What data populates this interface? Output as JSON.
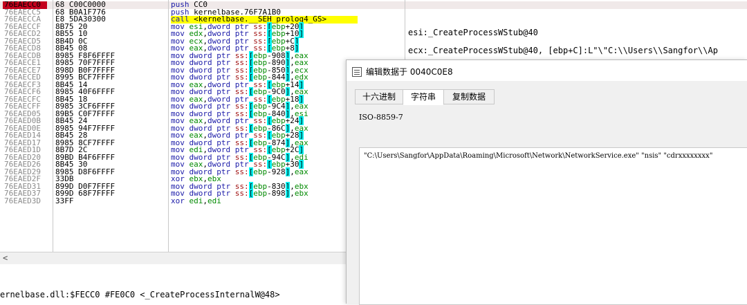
{
  "disasm": {
    "rows": [
      {
        "addr": "76EAECC0",
        "bytes": "68 C00C0000",
        "instr": "push CC0"
      },
      {
        "addr": "76EAECC5",
        "bytes": "68 B0A1F776",
        "instr": "push kernelbase.76F7A1B0"
      },
      {
        "addr": "76EAECCA",
        "bytes": "E8 5DA30300",
        "instr": "call <kernelbase.__SEH_prolog4_GS>"
      },
      {
        "addr": "76EAECCF",
        "bytes": "8B75 20",
        "instr": "mov esi,dword ptr ss:[ebp+20]"
      },
      {
        "addr": "76EAECD2",
        "bytes": "8B55 10",
        "instr": "mov edx,dword ptr ss:[ebp+10]"
      },
      {
        "addr": "76EAECD5",
        "bytes": "8B4D 0C",
        "instr": "mov ecx,dword ptr ss:[ebp+C]"
      },
      {
        "addr": "76EAECD8",
        "bytes": "8B45 08",
        "instr": "mov eax,dword ptr ss:[ebp+8]"
      },
      {
        "addr": "76EAECDB",
        "bytes": "8985 F8F6FFFF",
        "instr": "mov dword ptr ss:[ebp-908],eax"
      },
      {
        "addr": "76EAECE1",
        "bytes": "8985 70F7FFFF",
        "instr": "mov dword ptr ss:[ebp-890],eax"
      },
      {
        "addr": "76EAECE7",
        "bytes": "898D B0F7FFFF",
        "instr": "mov dword ptr ss:[ebp-850],ecx"
      },
      {
        "addr": "76EAECED",
        "bytes": "8995 BCF7FFFF",
        "instr": "mov dword ptr ss:[ebp-844],edx"
      },
      {
        "addr": "76EAECF3",
        "bytes": "8B45 14",
        "instr": "mov eax,dword ptr ss:[ebp+14]"
      },
      {
        "addr": "76EAECF6",
        "bytes": "8985 40F6FFFF",
        "instr": "mov dword ptr ss:[ebp-9C0],eax"
      },
      {
        "addr": "76EAECFC",
        "bytes": "8B45 18",
        "instr": "mov eax,dword ptr ss:[ebp+18]"
      },
      {
        "addr": "76EAECFF",
        "bytes": "8985 3CF6FFFF",
        "instr": "mov dword ptr ss:[ebp-9C4],eax"
      },
      {
        "addr": "76EAED05",
        "bytes": "89B5 C0F7FFFF",
        "instr": "mov dword ptr ss:[ebp-840],esi"
      },
      {
        "addr": "76EAED0B",
        "bytes": "8B45 24",
        "instr": "mov eax,dword ptr ss:[ebp+24]"
      },
      {
        "addr": "76EAED0E",
        "bytes": "8985 94F7FFFF",
        "instr": "mov dword ptr ss:[ebp-86C],eax"
      },
      {
        "addr": "76EAED14",
        "bytes": "8B45 28",
        "instr": "mov eax,dword ptr ss:[ebp+28]"
      },
      {
        "addr": "76EAED17",
        "bytes": "8985 8CF7FFFF",
        "instr": "mov dword ptr ss:[ebp-874],eax"
      },
      {
        "addr": "76EAED1D",
        "bytes": "8B7D 2C",
        "instr": "mov edi,dword ptr ss:[ebp+2C]"
      },
      {
        "addr": "76EAED20",
        "bytes": "89BD B4F6FFFF",
        "instr": "mov dword ptr ss:[ebp-94C],edi"
      },
      {
        "addr": "76EAED26",
        "bytes": "8B45 30",
        "instr": "mov eax,dword ptr ss:[ebp+30]"
      },
      {
        "addr": "76EAED29",
        "bytes": "8985 D8F6FFFF",
        "instr": "mov dword ptr ss:[ebp-928],eax"
      },
      {
        "addr": "76EAED2F",
        "bytes": "33DB",
        "instr": "xor ebx,ebx"
      },
      {
        "addr": "76EAED31",
        "bytes": "899D D0F7FFFF",
        "instr": "mov dword ptr ss:[ebp-830],ebx"
      },
      {
        "addr": "76EAED37",
        "bytes": "899D 68F7FFFF",
        "instr": "mov dword ptr ss:[ebp-898],ebx"
      },
      {
        "addr": "76EAED3D",
        "bytes": "33FF",
        "instr": "xor edi,edi"
      }
    ],
    "comments": [
      "esi:_CreateProcessWStub@40",
      "ecx:_CreateProcessWStub@40, [ebp+C]:L\"\\\"C:\\\\Users\\\\Sangfor\\\\Ap"
    ],
    "scroll_left_arrow": "<",
    "status": "ernelbase.dll:$FECC0 #FE0C0 <_CreateProcessInternalW@48>"
  },
  "dialog": {
    "title": "编辑数据于 0040C0E8",
    "tabs": [
      {
        "label": "十六进制",
        "active": false
      },
      {
        "label": "字符串",
        "active": true
      },
      {
        "label": "复制数据",
        "active": false
      }
    ],
    "encoding": "ISO-8859-7",
    "text_value": "\"C:\\Users\\Sangfor\\AppData\\Roaming\\Microsoft\\Network\\NetworkService.exe\" \"nsis\" \"cdrxxxxxxxx\""
  },
  "colors": {
    "current_address_bg": "#c4001d",
    "call_highlight": "#ffff00",
    "bracket_highlight": "#00f0f0",
    "mnemonic": "#1a1aa8",
    "register": "#008a00"
  }
}
